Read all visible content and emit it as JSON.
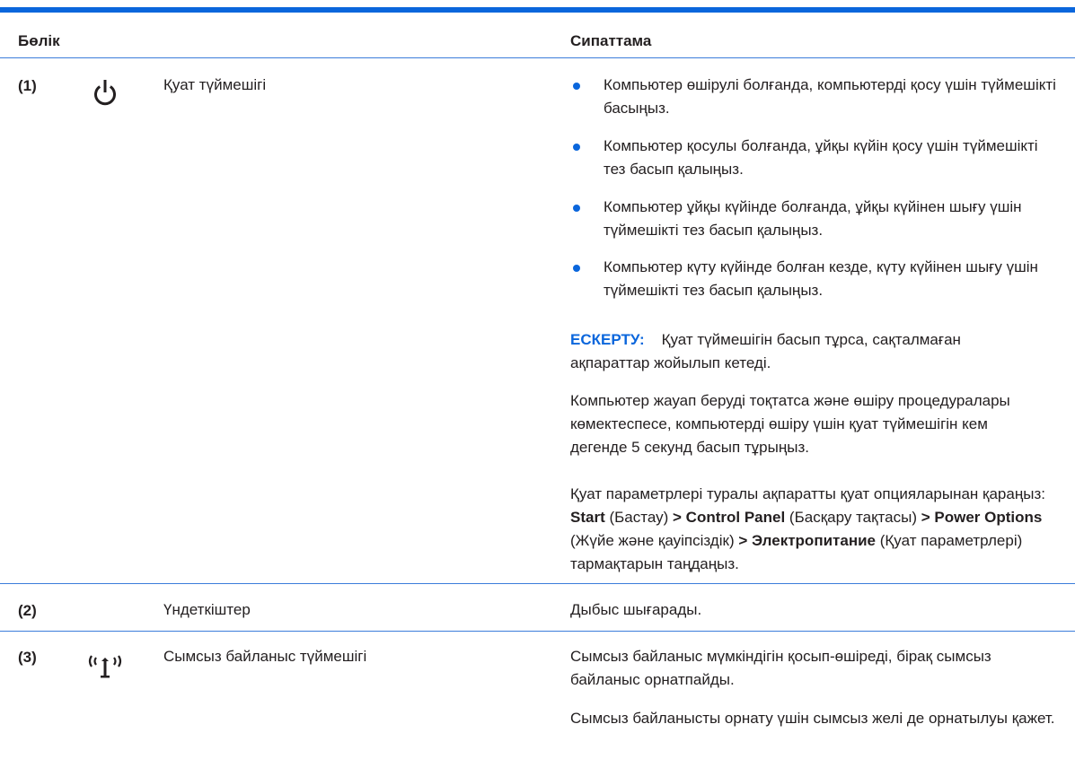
{
  "table": {
    "headers": {
      "part": "Бөлік",
      "description": "Сипаттама"
    },
    "rows": [
      {
        "number": "(1)",
        "icon": "power-icon",
        "name": "Қуат түймешігі",
        "bullets": [
          "Компьютер өшірулі болғанда, компьютерді қосу үшін түймешікті басыңыз.",
          "Компьютер қосулы болғанда, ұйқы күйін қосу үшін түймешікті тез басып қалыңыз.",
          "Компьютер ұйқы күйінде болғанда, ұйқы күйінен шығу үшін түймешікті тез басып қалыңыз.",
          "Компьютер күту күйінде болған кезде, күту күйінен шығу үшін түймешікті тез басып қалыңыз."
        ],
        "note_label": "ЕСКЕРТУ:",
        "note_text": "Қуат түймешігін басып тұрса, сақталмаған ақпараттар жойылып кетеді.",
        "paragraph": "Компьютер жауап беруді тоқтатса және өшіру процедуралары көмектеспесе, компьютерді өшіру үшін қуат түймешігін кем дегенде 5 секунд басып тұрыңыз.",
        "path_intro": "Қуат параметрлері туралы ақпаратты қуат опцияларынан қараңыз:",
        "path_start": "Start",
        "path_start_note": "(Бастау)",
        "path_sep": ">",
        "path_control": "Control Panel",
        "path_control_note": "(Басқару тақтасы)",
        "path_power": "Power Options",
        "path_power_note": "(Жүйе және қауіпсіздік)",
        "path_electro": "Электропитание",
        "path_end": "(Қуат параметрлері) тармақтарын таңдаңыз."
      },
      {
        "number": "(2)",
        "name": "Үндеткіштер",
        "description": "Дыбыс шығарады."
      },
      {
        "number": "(3)",
        "icon": "wireless-icon",
        "name": "Сымсыз байланыс түймешігі",
        "description": "Сымсыз байланыс мүмкіндігін қосып-өшіреді, бірақ сымсыз байланыс орнатпайды.",
        "description2": "Сымсыз байланысты орнату үшін сымсыз желі де орнатылуы қажет."
      }
    ]
  }
}
